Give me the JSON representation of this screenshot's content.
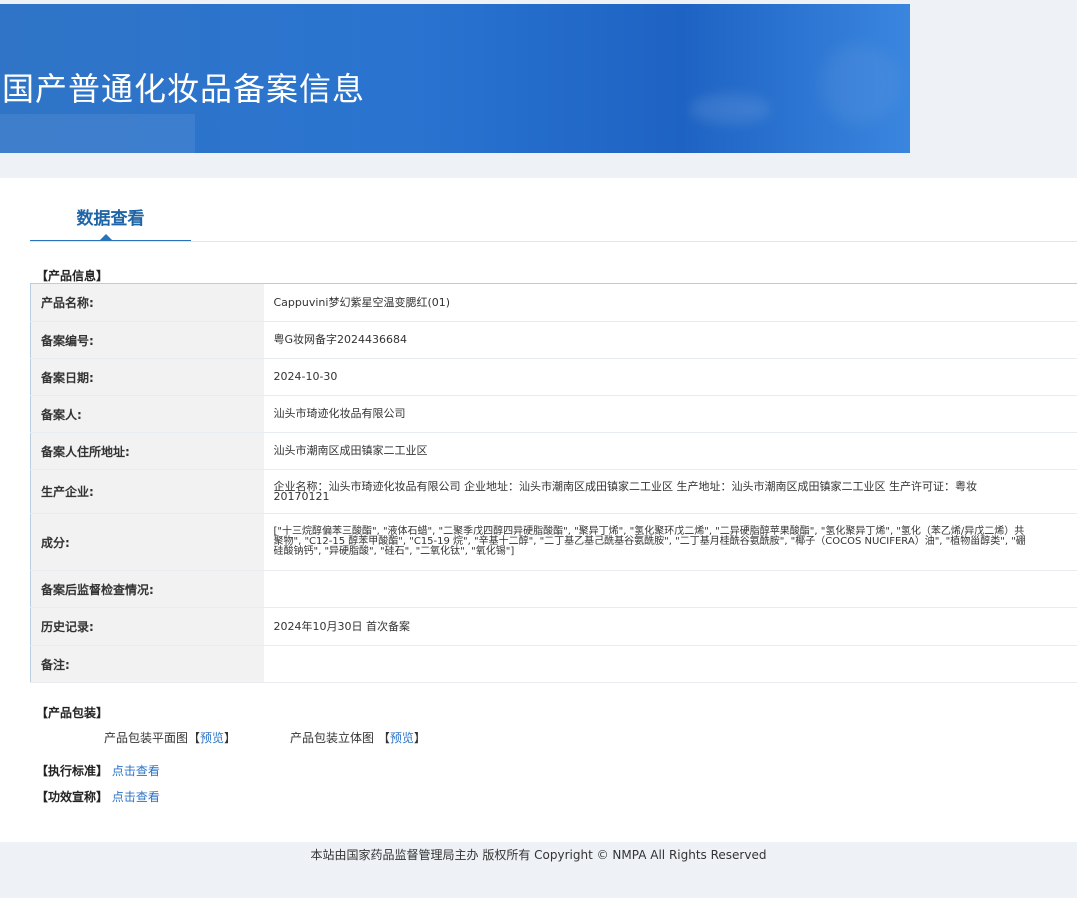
{
  "header": {
    "title": "国产普通化妆品备案信息"
  },
  "tab": {
    "label": "数据查看"
  },
  "product_info": {
    "section_title": "【产品信息】",
    "rows": [
      {
        "label": "产品名称:",
        "value": "Cappuvini梦幻紫星空温变腮红(01)"
      },
      {
        "label": "备案编号:",
        "value": "粤G妆网备字2024436684"
      },
      {
        "label": "备案日期:",
        "value": "2024-10-30"
      },
      {
        "label": "备案人:",
        "value": "汕头市琦迹化妆品有限公司"
      },
      {
        "label": "备案人住所地址:",
        "value": "汕头市潮南区成田镇家二工业区"
      },
      {
        "label": "生产企业:",
        "value": "企业名称：汕头市琦迹化妆品有限公司 企业地址：汕头市潮南区成田镇家二工业区 生产地址：汕头市潮南区成田镇家二工业区 生产许可证：粤妆20170121"
      },
      {
        "label": "成分:",
        "value": "[\"十三烷醇偏苯三酸酯\", \"液体石蜡\", \"二聚季戊四醇四异硬脂酸酯\", \"聚异丁烯\", \"氢化聚环戊二烯\", \"二异硬脂醇苹果酸酯\", \"氢化聚异丁烯\", \"氢化（苯乙烯/异戊二烯）共聚物\", \"C12-15 醇苯甲酸酯\", \"C15-19 烷\", \"辛基十二醇\", \"二丁基乙基己酰基谷氨酰胺\", \"二丁基月桂酰谷氨酰胺\", \"椰子（COCOS NUCIFERA）油\", \"植物甾醇类\", \"硼硅酸钠钙\", \"异硬脂酸\", \"硅石\", \"二氧化钛\", \"氧化锡\"]"
      },
      {
        "label": "备案后监督检查情况:",
        "value": ""
      },
      {
        "label": "历史记录:",
        "value": "2024年10月30日 首次备案"
      },
      {
        "label": "备注:",
        "value": ""
      }
    ]
  },
  "packaging": {
    "section_title": "【产品包装】",
    "flat_label": "产品包装平面图",
    "solid_label": "产品包装立体图",
    "bracket_open": "【",
    "bracket_close": "】",
    "preview_label": "预览"
  },
  "standards": {
    "label": "【执行标准】",
    "link": "点击查看"
  },
  "efficacy": {
    "label": "【功效宣称】",
    "link": "点击查看"
  },
  "footer": {
    "text": "本站由国家药品监督管理局主办 版权所有 Copyright © NMPA All Rights Reserved"
  }
}
